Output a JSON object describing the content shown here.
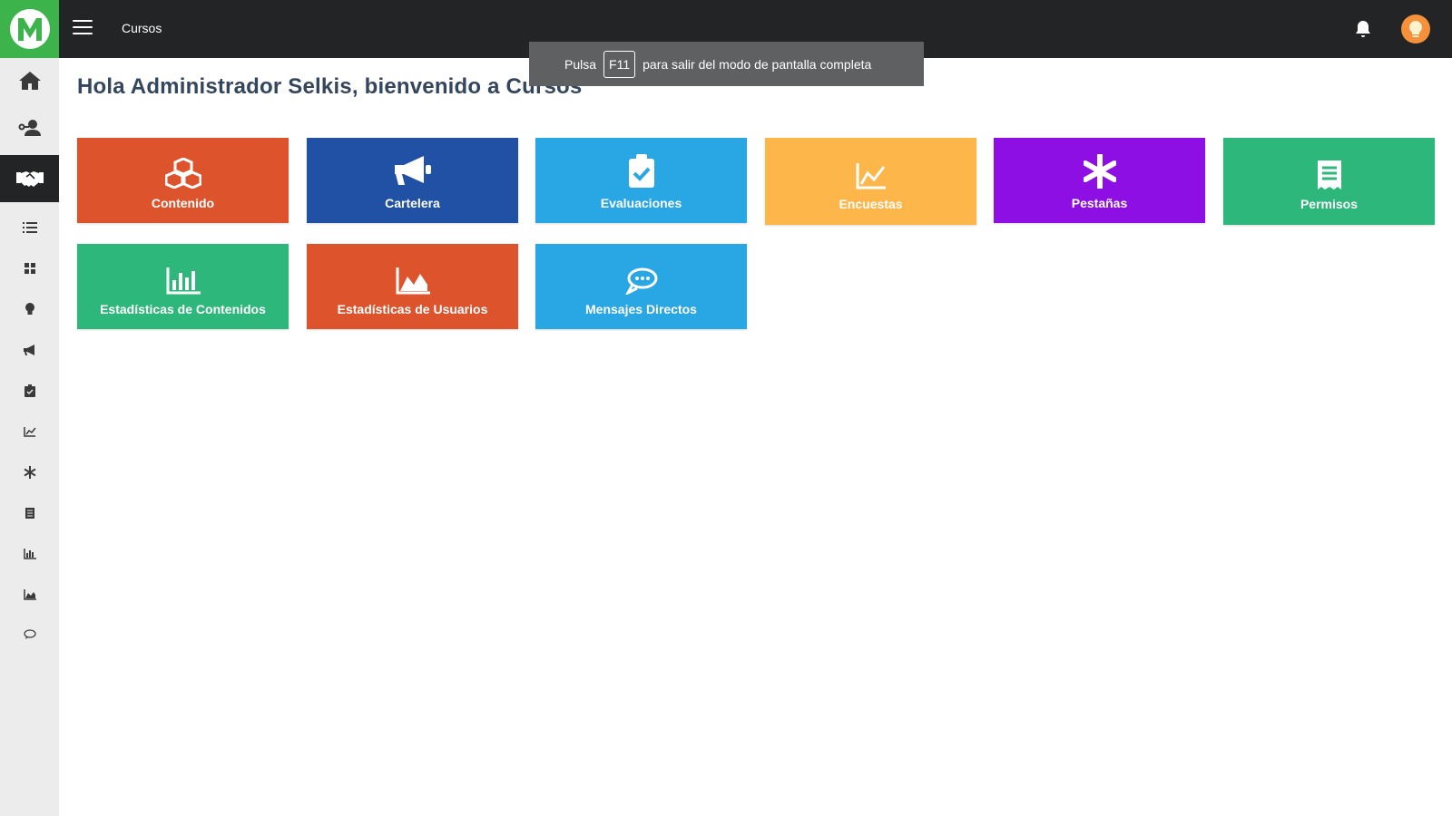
{
  "header": {
    "logo_letter": "M",
    "title": "Cursos",
    "logo_color": "#3cb44b",
    "bar_color": "#232425"
  },
  "fullscreen_toast": {
    "prefix": "Pulsa",
    "key": "F11",
    "suffix": "para salir del modo de pantalla completa"
  },
  "greeting": "Hola Administrador Selkis, bienvenido a Cursos",
  "sidebar": {
    "items": [
      {
        "icon": "home-icon"
      },
      {
        "icon": "user-key-icon"
      },
      {
        "icon": "handshake-icon",
        "active": true
      },
      {
        "icon": "list-icon"
      },
      {
        "icon": "cubes-icon"
      },
      {
        "icon": "lightbulb-icon"
      },
      {
        "icon": "megaphone-icon"
      },
      {
        "icon": "clipboard-check-icon"
      },
      {
        "icon": "chart-line-icon"
      },
      {
        "icon": "asterisk-icon"
      },
      {
        "icon": "receipt-icon"
      },
      {
        "icon": "bar-chart-icon"
      },
      {
        "icon": "area-chart-icon"
      },
      {
        "icon": "chat-icon"
      }
    ]
  },
  "tiles": [
    {
      "label": "Contenido",
      "icon": "cubes-icon",
      "color": "#dd532c"
    },
    {
      "label": "Cartelera",
      "icon": "megaphone-icon",
      "color": "#2051a5"
    },
    {
      "label": "Evaluaciones",
      "icon": "clipboard-check-icon",
      "color": "#29a6e4"
    },
    {
      "label": "Encuestas",
      "icon": "chart-line-icon",
      "color": "#fdb649"
    },
    {
      "label": "Pestañas",
      "icon": "asterisk-icon",
      "color": "#8e0fe3"
    },
    {
      "label": "Permisos",
      "icon": "receipt-icon",
      "color": "#2db77a"
    },
    {
      "label": "Estadísticas de Contenidos",
      "icon": "bar-chart-icon",
      "color": "#2db77a"
    },
    {
      "label": "Estadísticas de Usuarios",
      "icon": "area-chart-icon",
      "color": "#dd532c"
    },
    {
      "label": "Mensajes Directos",
      "icon": "chat-icon",
      "color": "#29a6e4"
    }
  ]
}
